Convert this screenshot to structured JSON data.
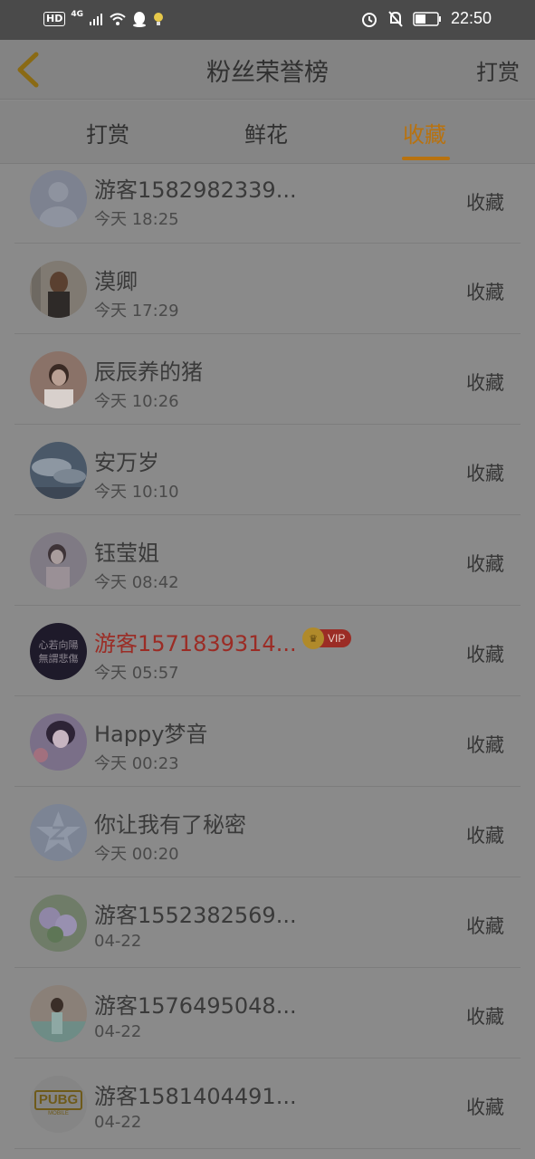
{
  "status_bar": {
    "hd": "HD",
    "network": "4G",
    "time": "22:50"
  },
  "header": {
    "title": "粉丝荣誉榜",
    "right_action": "打赏"
  },
  "tabs": [
    {
      "label": "打赏",
      "active": false
    },
    {
      "label": "鲜花",
      "active": false
    },
    {
      "label": "收藏",
      "active": true
    }
  ],
  "colors": {
    "accent": "#b8720f",
    "vip_name": "#9b2c25",
    "overlay_bg": "#8a8a8a"
  },
  "fans": [
    {
      "name": "游客1582982339...",
      "time": "今天 18:25",
      "action": "收藏",
      "avatar": "default-user"
    },
    {
      "name": "漠卿",
      "time": "今天 17:29",
      "action": "收藏",
      "avatar": "photo"
    },
    {
      "name": "辰辰养的猪",
      "time": "今天 10:26",
      "action": "收藏",
      "avatar": "photo"
    },
    {
      "name": "安万岁",
      "time": "今天 10:10",
      "action": "收藏",
      "avatar": "photo"
    },
    {
      "name": "钰莹姐",
      "time": "今天 08:42",
      "action": "收藏",
      "avatar": "photo"
    },
    {
      "name": "游客1571839314...",
      "time": "今天 05:57",
      "action": "收藏",
      "avatar": "calligraphy",
      "avatar_text": [
        "心若向陽",
        "無謂悲傷"
      ],
      "vip": true,
      "vip_label": "VIP"
    },
    {
      "name": "Happy梦音",
      "time": "今天 00:23",
      "action": "收藏",
      "avatar": "photo"
    },
    {
      "name": "你让我有了秘密",
      "time": "今天 00:20",
      "action": "收藏",
      "avatar": "qq-star"
    },
    {
      "name": "游客1552382569...",
      "time": "04-22",
      "action": "收藏",
      "avatar": "photo"
    },
    {
      "name": "游客1576495048...",
      "time": "04-22",
      "action": "收藏",
      "avatar": "photo"
    },
    {
      "name": "游客1581404491...",
      "time": "04-22",
      "action": "收藏",
      "avatar": "pubg-logo",
      "avatar_text": [
        "PUBG",
        "MOBILE"
      ]
    }
  ]
}
